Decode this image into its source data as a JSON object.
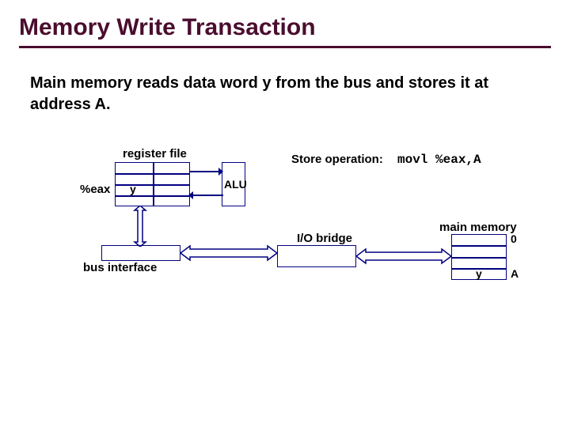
{
  "title": "Memory Write Transaction",
  "subtitle": "Main memory reads data word y from the bus and stores it at address A.",
  "labels": {
    "register_file": "register file",
    "eax": "%eax",
    "yreg": "y",
    "alu": "ALU",
    "store_op": "Store operation:",
    "instr": "movl %eax,A",
    "io_bridge": "I/O bridge",
    "main_memory": "main memory",
    "zero": "0",
    "ymem": "y",
    "addrA": "A",
    "bus_interface": "bus interface"
  }
}
